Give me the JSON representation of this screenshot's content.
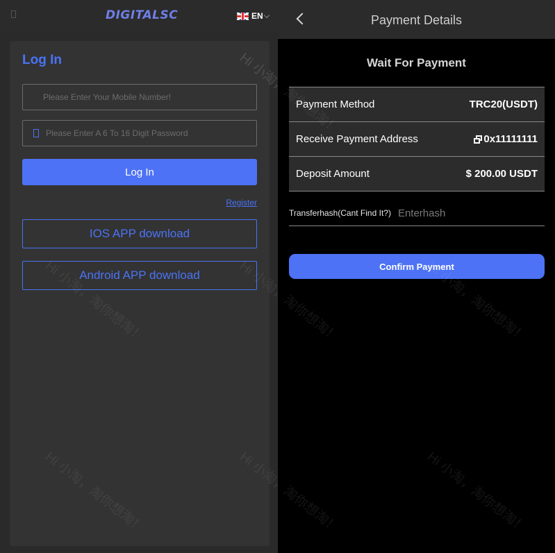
{
  "left": {
    "logo": "DIGITALSC",
    "language": {
      "flag_icon": "uk-flag-icon",
      "label": "EN"
    },
    "login": {
      "title": "Log In",
      "phone_placeholder": "Please Enter Your Mobile Number!",
      "password_placeholder": "Please Enter A 6 To 16 Digit Password",
      "submit_label": "Log In",
      "register_link": "Register",
      "ios_download": "IOS APP download",
      "android_download": "Android APP download"
    }
  },
  "right": {
    "header": {
      "back_icon": "chevron-left-icon",
      "title": "Payment Details"
    },
    "status": "Wait For Payment",
    "details": [
      {
        "label": "Payment Method",
        "value": "TRC20(USDT)"
      },
      {
        "label": "Receive Payment Address",
        "value": "0x11111111",
        "icon": "copy-icon"
      },
      {
        "label": "Deposit Amount",
        "value": "$ 200.00 USDT"
      }
    ],
    "transfer_hash": {
      "label": "Transferhash(Cant Find It?)",
      "placeholder": "Enterhash"
    },
    "confirm_label": "Confirm Payment"
  },
  "watermark": "Hi 小淘，淘你想淘！",
  "colors": {
    "accent": "#4d72f5",
    "left_background": "#2a2a2a",
    "card_background": "#333333",
    "right_background": "#000000",
    "header_background": "#2b2b2b",
    "row_background": "#2c2c2c"
  }
}
